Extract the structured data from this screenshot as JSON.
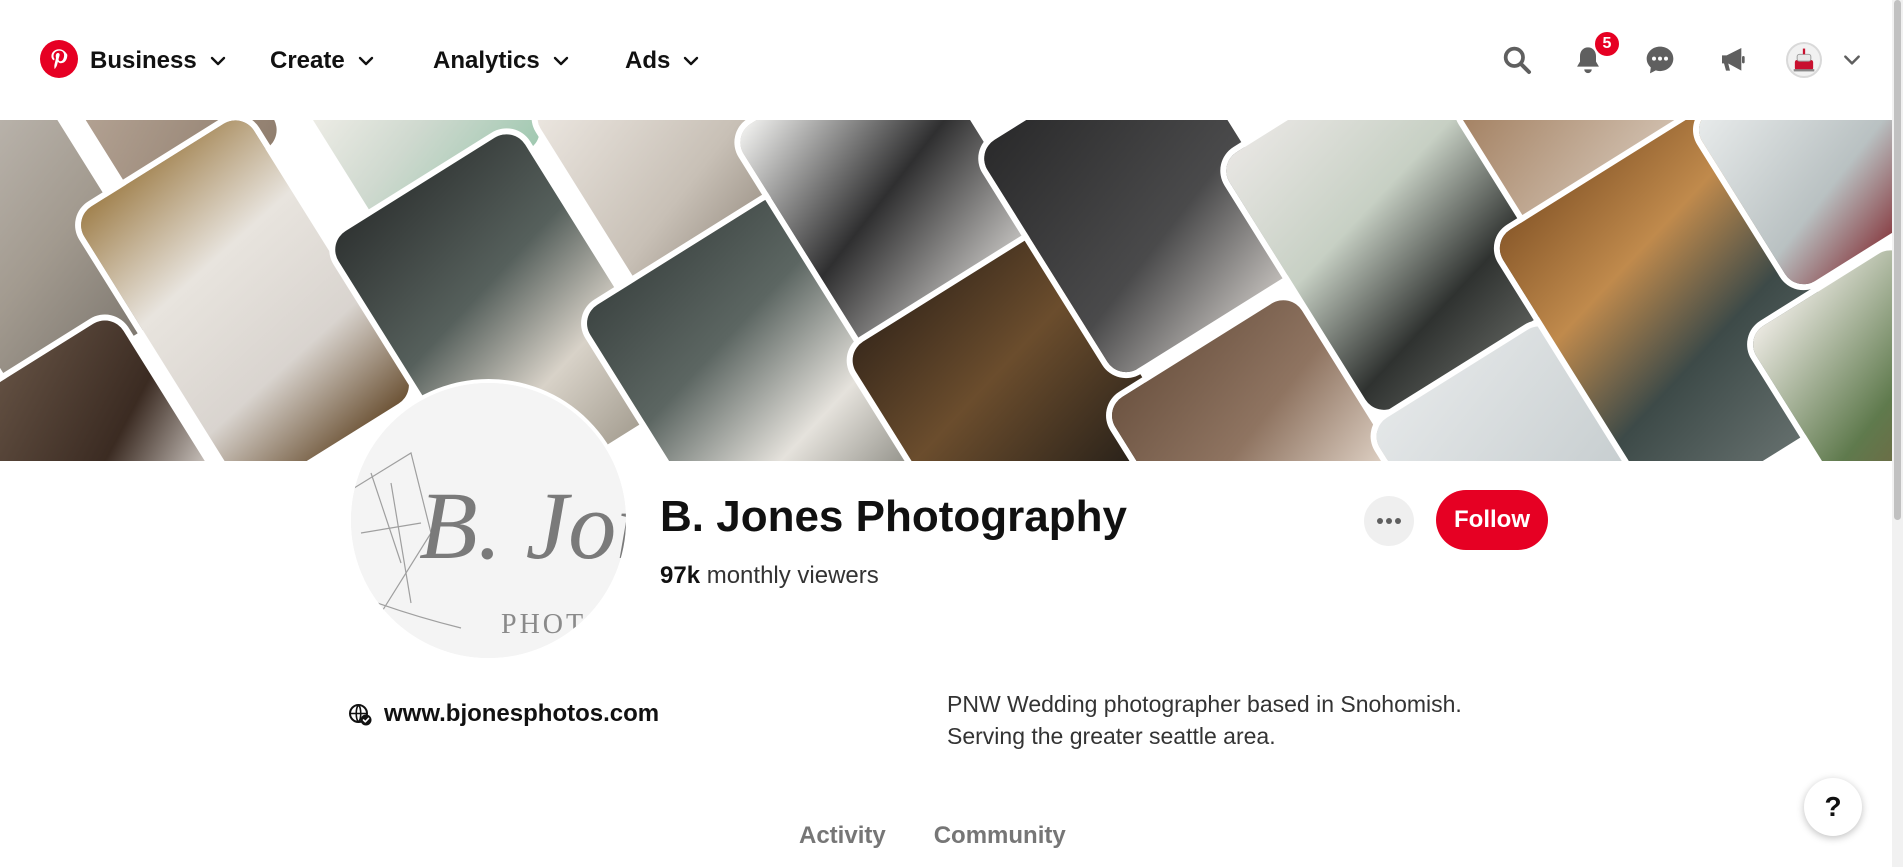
{
  "nav": {
    "business": "Business",
    "create": "Create",
    "analytics": "Analytics",
    "ads": "Ads",
    "notification_count": "5",
    "icons": [
      "pinterest-logo",
      "search-icon",
      "bell-icon",
      "message-icon",
      "megaphone-icon",
      "avatar",
      "chevron-down-icon"
    ]
  },
  "profile": {
    "name": "B. Jones Photography",
    "viewers_count": "97k",
    "viewers_label": " monthly viewers",
    "avatar_text": "B. Jon",
    "avatar_subtext": "PHOTO",
    "follow_label": "Follow",
    "more_label": "•••",
    "website": "www.bjonesphotos.com",
    "bio_line1": "PNW Wedding photographer based in Snohomish.",
    "bio_line2": "Serving the greater seattle area."
  },
  "tabs": [
    {
      "label": "Activity"
    },
    {
      "label": "Community"
    }
  ],
  "help_label": "?",
  "colors": {
    "brand_red": "#e60023",
    "text_primary": "#111111",
    "tab_inactive": "#767676"
  }
}
